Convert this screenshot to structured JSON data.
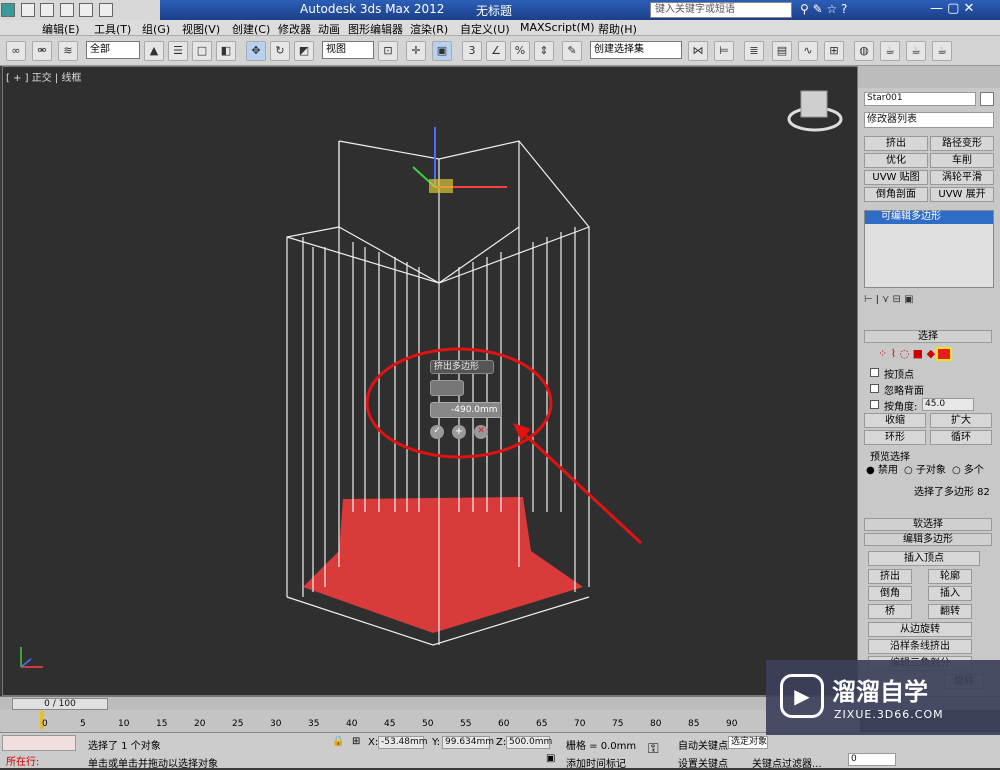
{
  "titlebar": {
    "title": "Autodesk 3ds Max  2012",
    "doc": "无标题",
    "search_placeholder": "键入关键字或短语"
  },
  "menu": [
    "编辑(E)",
    "工具(T)",
    "组(G)",
    "视图(V)",
    "创建(C)",
    "修改器",
    "动画",
    "图形编辑器",
    "渲染(R)",
    "自定义(U)",
    "MAXScript(M)",
    "帮助(H)"
  ],
  "toolbar": {
    "selection_filter": "全部",
    "ref_coord": "视图",
    "named_sel": "创建选择集",
    "snap3": "3",
    "snap_n": "n"
  },
  "viewport": {
    "label": "[ + ] 正交 | 线框"
  },
  "caddy": {
    "title": "挤出多边形",
    "value": "-490.0mm"
  },
  "panel": {
    "object_name": "Star001",
    "modifier_list": "修改器列表",
    "modifier_buttons": [
      "挤出",
      "路径变形",
      "优化",
      "车削",
      "UVW 贴图",
      "涡轮平滑",
      "倒角剖面",
      "UVW 展开"
    ],
    "stack_item": "可编辑多边形",
    "rollout_select": "选择",
    "by_vertex": "按顶点",
    "ignore_back": "忽略背面",
    "by_angle": "按角度:",
    "angle_value": "45.0",
    "shrink": "收缩",
    "grow": "扩大",
    "ring": "环形",
    "loop": "循环",
    "preview": "预览选择",
    "preview_opts": [
      "禁用",
      "子对象",
      "多个"
    ],
    "sel_info": "选择了多边形 82",
    "soft_select": "软选择",
    "edit_poly": "编辑多边形",
    "insert_vertex": "插入顶点",
    "ops": [
      "挤出",
      "轮廓",
      "倒角",
      "插入",
      "桥",
      "翻转"
    ],
    "hinge": "从边旋转",
    "extrude_spline": "沿样条线挤出",
    "edit_tri": "编辑三角剖分",
    "rotate": "旋转"
  },
  "timeline": {
    "frame": "0 / 100",
    "ticks": [
      "0",
      "5",
      "10",
      "15",
      "20",
      "25",
      "30",
      "35",
      "40",
      "45",
      "50",
      "55",
      "60",
      "65",
      "70",
      "75",
      "80",
      "85",
      "90"
    ]
  },
  "status": {
    "selected": "选择了 1 个对象",
    "prompt": "单击或单击并拖动以选择对象",
    "now_running": "所在行:",
    "x_label": "X:",
    "x": "-53.48mm",
    "y_label": "Y:",
    "y": "99.634mm",
    "z_label": "Z:",
    "z": "500.0mm",
    "grid": "栅格 = 0.0mm",
    "add_tag": "添加时间标记",
    "autokey": "自动关键点",
    "selected_obj": "选定对象",
    "setkey": "设置关键点",
    "key_filters": "关键点过滤器...",
    "frame_field": "0"
  },
  "watermark": {
    "brand": "溜溜自学",
    "url": "ZIXUE.3D66.COM"
  }
}
